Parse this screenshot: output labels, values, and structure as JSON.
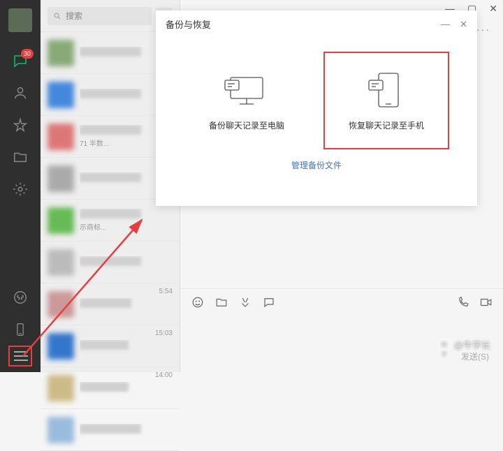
{
  "window_controls": {
    "min": "—",
    "max": "▢",
    "close": "✕"
  },
  "sidebar": {
    "chat_badge": "30",
    "icons": [
      "chat-icon",
      "contacts-icon",
      "favorites-icon",
      "files-icon",
      "settings-icon"
    ],
    "bottom_icons": [
      "miniprogram-icon",
      "phone-icon",
      "menu-icon"
    ]
  },
  "search": {
    "placeholder": "搜索"
  },
  "chat_items": [
    {
      "time": "",
      "sub": ""
    },
    {
      "time": "",
      "sub": ""
    },
    {
      "time": "",
      "sub": "71 半数..."
    },
    {
      "time": "",
      "sub": ""
    },
    {
      "time": "",
      "sub": "示商标..."
    },
    {
      "time": "",
      "sub": ""
    },
    {
      "time": "5:54",
      "sub": ""
    },
    {
      "time": "15:03",
      "sub": ""
    },
    {
      "time": "14:00",
      "sub": ""
    },
    {
      "time": "",
      "sub": ""
    }
  ],
  "modal": {
    "title": "备份与恢复",
    "option_backup": "备份聊天记录至电脑",
    "option_restore": "恢复聊天记录至手机",
    "manage": "管理备份文件",
    "selected": "restore"
  },
  "composer": {
    "send_label": "发送(S)"
  },
  "watermark": {
    "brand": "知乎",
    "author": "@牛学长"
  }
}
